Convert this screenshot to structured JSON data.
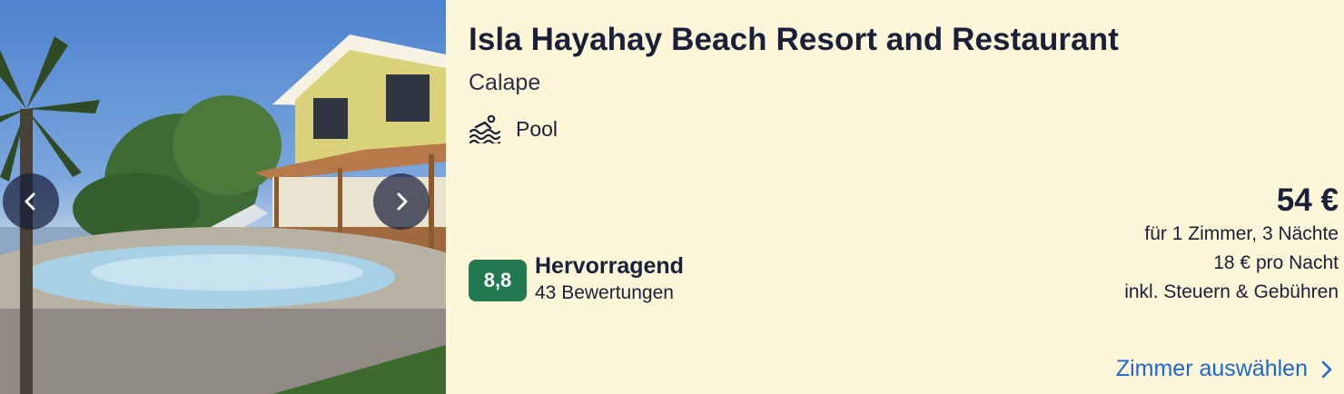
{
  "hotel": {
    "name": "Isla Hayahay Beach Resort and Restaurant",
    "location": "Calape",
    "amenity": {
      "icon": "pool-icon",
      "label": "Pool"
    }
  },
  "gallery": {
    "prev_icon": "chevron-left-icon",
    "next_icon": "chevron-right-icon"
  },
  "rating": {
    "score": "8,8",
    "label": "Hervorragend",
    "reviews": "43 Bewertungen",
    "badge_color": "#227950"
  },
  "price": {
    "amount": "54 €",
    "detail": "für 1 Zimmer, 3 Nächte",
    "per_night": "18 € pro Nacht",
    "taxes": "inkl. Steuern & Gebühren"
  },
  "cta": {
    "label": "Zimmer auswählen",
    "icon": "chevron-right-icon",
    "color": "#1b68d0"
  },
  "colors": {
    "background": "#fdf6d8",
    "text": "#1a1f3a"
  }
}
